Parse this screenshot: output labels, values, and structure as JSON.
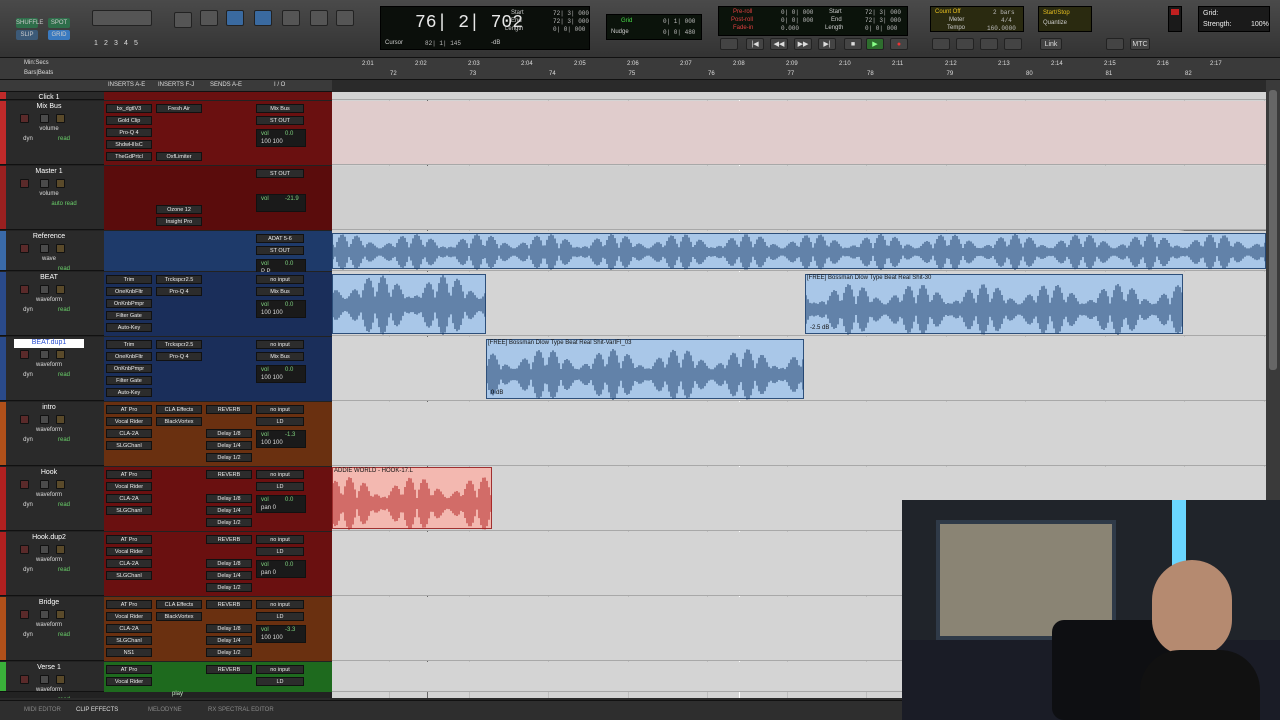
{
  "toolbar": {
    "shuffle": "SHUFFLE",
    "spot": "SPOT",
    "slip": "SLIP",
    "grid": "GRID",
    "zoom_presets": [
      "1",
      "2",
      "3",
      "4",
      "5"
    ],
    "counter_main": "76| 2| 702",
    "counter_mode": "Cursor",
    "counter_cursor": "82| 1| 145",
    "counter_db": "-dB",
    "sel_start_label": "Start",
    "sel_end_label": "End",
    "sel_length_label": "Length",
    "sel_start": "72| 3| 000",
    "sel_end": "72| 3| 000",
    "sel_length": "0| 0| 000",
    "grid_label": "Grid",
    "grid_value": "0| 1| 000",
    "nudge_label": "Nudge",
    "nudge_value": "0| 0| 480",
    "preroll_label": "Pre-roll",
    "postroll_label": "Post-roll",
    "fadein_label": "Fade-in",
    "preroll": "0| 0| 000",
    "postroll": "0| 0| 000",
    "fadein": "0.000",
    "tstart": "72| 3| 000",
    "tend": "72| 3| 000",
    "tlength": "0| 0| 000",
    "countoff": "Count Off",
    "countoff_val": "2 bars",
    "meter_label": "Meter",
    "meter": "4/4",
    "tempo_label": "Tempo",
    "tempo": "160.0000",
    "startstop": "Start/Stop",
    "quantize": "Quantize",
    "link": "Link",
    "midi": "MTC",
    "grid_lbl2": "Grid:",
    "strength_label": "Strength:",
    "strength": "100%"
  },
  "ruler": {
    "minsecs": "Min:Secs",
    "barsbeats": "Bars|Beats",
    "times": [
      "2:01",
      "2:02",
      "2:03",
      "2:04",
      "2:05",
      "2:06",
      "2:07",
      "2:08",
      "2:09",
      "2:10",
      "2:11",
      "2:12",
      "2:13",
      "2:14",
      "2:15",
      "2:16",
      "2:17"
    ],
    "bars": [
      "72",
      "73",
      "74",
      "75",
      "76",
      "77",
      "78",
      "79",
      "80",
      "81",
      "82"
    ]
  },
  "header": {
    "inserts_ae": "INSERTS A-E",
    "inserts_fj": "INSERTS F-J",
    "sends_ae": "SENDS A-E",
    "io": "I / O"
  },
  "tracks": [
    {
      "name": "Click 1",
      "color": "#c02a2a",
      "h": 8,
      "ins1": [],
      "ins2": [],
      "sends": [],
      "in": "",
      "out": ""
    },
    {
      "name": "Mix Bus",
      "color": "#c02a2a",
      "h": 64,
      "view": "volume",
      "mode": "read",
      "dyn": "dyn",
      "ins1": [
        "bx_dgtlV3",
        "Gold Clip",
        "Pro-Q 4",
        "ShdwHIIsC",
        "TheGdPrtcl"
      ],
      "ins2": [
        "Fresh Air",
        "",
        "",
        "",
        "OxfLimiter"
      ],
      "sends": [],
      "in": "Mix Bus",
      "out": "ST OUT",
      "vol": "0.0",
      "pan": "100  100"
    },
    {
      "name": "Master 1",
      "color": "#9a2020",
      "h": 64,
      "view": "volume",
      "mode": "auto read",
      "ins1": [],
      "ins2": [
        "",
        "",
        "",
        "Ozone 12",
        "Insight Pro"
      ],
      "sends": [],
      "in": "ST OUT",
      "out": "",
      "vol": "-21.9",
      "pan": ""
    },
    {
      "name": "Reference",
      "color": "#3a6aa8",
      "h": 40,
      "view": "wave",
      "mode": "read",
      "ins1": [],
      "ins2": [],
      "sends": [],
      "in": "ADAT 5-6",
      "out": "ST OUT",
      "vol": "0.0",
      "pan": "P  P"
    },
    {
      "name": "BEAT",
      "color": "#2a4a8a",
      "h": 64,
      "view": "waveform",
      "mode": "read",
      "dyn": "dyn",
      "ins1": [
        "Trim",
        "OneKnbFltr",
        "OnKnbPmpr",
        "Filter Gate",
        "Auto-Key"
      ],
      "ins2": [
        "Trckspcr2.5",
        "Pro-Q 4"
      ],
      "sends": [],
      "in": "no input",
      "out": "Mix Bus",
      "vol": "0.0",
      "pan": "100  100"
    },
    {
      "name": "BEAT.dup1",
      "color": "#2a4a8a",
      "h": 64,
      "view": "waveform",
      "mode": "read",
      "dyn": "dyn",
      "selected": true,
      "ins1": [
        "Trim",
        "OneKnbFltr",
        "OnKnbPmpr",
        "Filter Gate",
        "Auto-Key"
      ],
      "ins2": [
        "Trckspcr2.5",
        "Pro-Q 4"
      ],
      "sends": [],
      "in": "no input",
      "out": "Mix Bus",
      "vol": "0.0",
      "pan": "100  100"
    },
    {
      "name": "intro",
      "color": "#b0501a",
      "h": 64,
      "view": "waveform",
      "mode": "read",
      "dyn": "dyn",
      "ins1": [
        "AT Pro",
        "Vocal Rider",
        "CLA-2A",
        "SLGChanl"
      ],
      "ins2": [
        "CLA Effects",
        "BlackVortex"
      ],
      "sends": [
        "REVERB",
        "",
        "Delay 1/8",
        "Delay 1/4",
        "Delay 1/2"
      ],
      "in": "no input",
      "out": "LD",
      "vol": "-1.3",
      "pan": "100  100"
    },
    {
      "name": "Hook",
      "color": "#b02020",
      "h": 64,
      "view": "waveform",
      "mode": "read",
      "dyn": "dyn",
      "ins1": [
        "AT Pro",
        "Vocal Rider",
        "CLA-2A",
        "SLGChanl"
      ],
      "ins2": [],
      "sends": [
        "REVERB",
        "",
        "Delay 1/8",
        "Delay 1/4",
        "Delay 1/2"
      ],
      "in": "no input",
      "out": "LD",
      "vol": "0.0",
      "pan": "pan  0"
    },
    {
      "name": "Hook.dup2",
      "color": "#b02020",
      "h": 64,
      "view": "waveform",
      "mode": "read",
      "dyn": "dyn",
      "ins1": [
        "AT Pro",
        "Vocal Rider",
        "CLA-2A",
        "SLGChanl"
      ],
      "ins2": [],
      "sends": [
        "REVERB",
        "",
        "Delay 1/8",
        "Delay 1/4",
        "Delay 1/2"
      ],
      "in": "no input",
      "out": "LD",
      "vol": "0.0",
      "pan": "pan  0"
    },
    {
      "name": "Bridge",
      "color": "#b0501a",
      "h": 64,
      "view": "waveform",
      "mode": "read",
      "dyn": "dyn",
      "ins1": [
        "AT Pro",
        "Vocal Rider",
        "CLA-2A",
        "SLGChanl",
        "NS1"
      ],
      "ins2": [
        "CLA Effects",
        "BlackVortex"
      ],
      "sends": [
        "REVERB",
        "",
        "Delay 1/8",
        "Delay 1/4",
        "Delay 1/2"
      ],
      "in": "no input",
      "out": "LD",
      "vol": "-3.3",
      "pan": "100  100"
    },
    {
      "name": "Verse 1",
      "color": "#3ab03a",
      "h": 30,
      "view": "waveform",
      "mode": "read",
      "ins1": [
        "AT Pro",
        "Vocal Rider"
      ],
      "ins2": [],
      "sends": [
        "REVERB",
        ""
      ],
      "in": "no input",
      "out": "LD",
      "vol": "",
      "pan": ""
    }
  ],
  "clips": {
    "beat_right": "[FREE] Bossman Dlow Type Beat Real Shit-30",
    "beat_right_gain": "-2.5 dB",
    "dup_clip": "[FREE] Bossman Dlow Type Beat Real Shit-VarIFI_03",
    "dup_gain": "0 dB",
    "hook_clip": "ADDIE WORLD - HOOK-17.L"
  },
  "status": {
    "play": "play"
  },
  "bottom_tabs": [
    "MIDI EDITOR",
    "CLIP EFFECTS",
    "MELODYNE",
    "RX SPECTRAL EDITOR"
  ]
}
